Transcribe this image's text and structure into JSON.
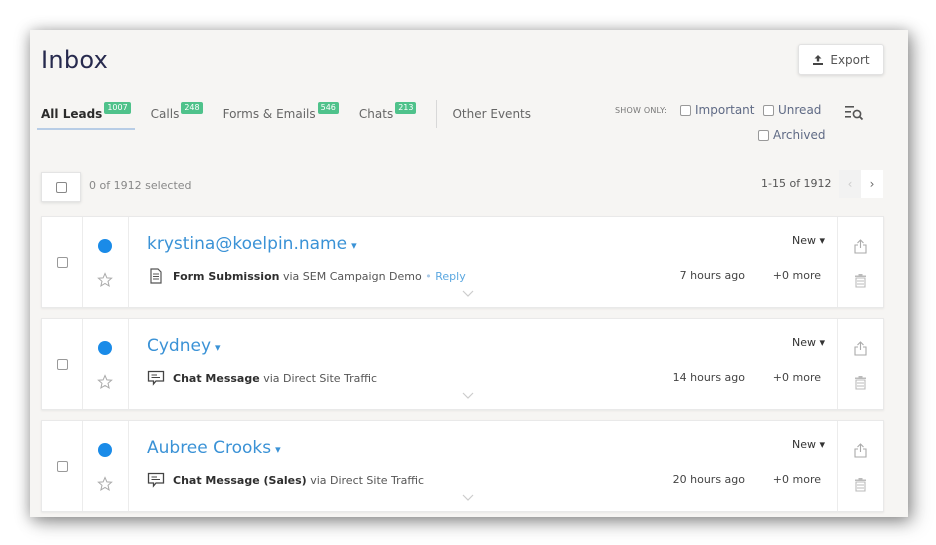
{
  "header": {
    "title": "Inbox",
    "export_label": "Export"
  },
  "tabs": [
    {
      "label": "All Leads",
      "count": "1007",
      "active": true
    },
    {
      "label": "Calls",
      "count": "248"
    },
    {
      "label": "Forms & Emails",
      "count": "546"
    },
    {
      "label": "Chats",
      "count": "213"
    },
    {
      "label": "Other Events"
    }
  ],
  "filters": {
    "show_only_label": "SHOW ONLY:",
    "options": [
      "Important",
      "Unread",
      "Archived"
    ]
  },
  "selection": {
    "text": "0 of 1912 selected"
  },
  "pagination": {
    "text": "1-15 of 1912",
    "prev": "‹",
    "next": "›"
  },
  "leads": [
    {
      "name": "krystina@koelpin.name",
      "icon": "form-icon",
      "type": "Form Submission",
      "via": "via SEM Campaign Demo",
      "reply": "Reply",
      "separator": "•",
      "status": "New",
      "time": "7 hours ago",
      "more": "+0 more",
      "unread": true
    },
    {
      "name": "Cydney",
      "icon": "chat-icon",
      "type": "Chat Message",
      "via": "via Direct Site Traffic",
      "status": "New",
      "time": "14 hours ago",
      "more": "+0 more",
      "unread": true
    },
    {
      "name": "Aubree Crooks",
      "icon": "chat-icon",
      "type": "Chat Message (Sales)",
      "via": "via Direct Site Traffic",
      "status": "New",
      "time": "20 hours ago",
      "more": "+0 more",
      "unread": true
    }
  ],
  "colors": {
    "accent": "#3a92d6",
    "badge": "#4fc28b",
    "unread_dot": "#1a8be8",
    "title": "#272a4e"
  }
}
